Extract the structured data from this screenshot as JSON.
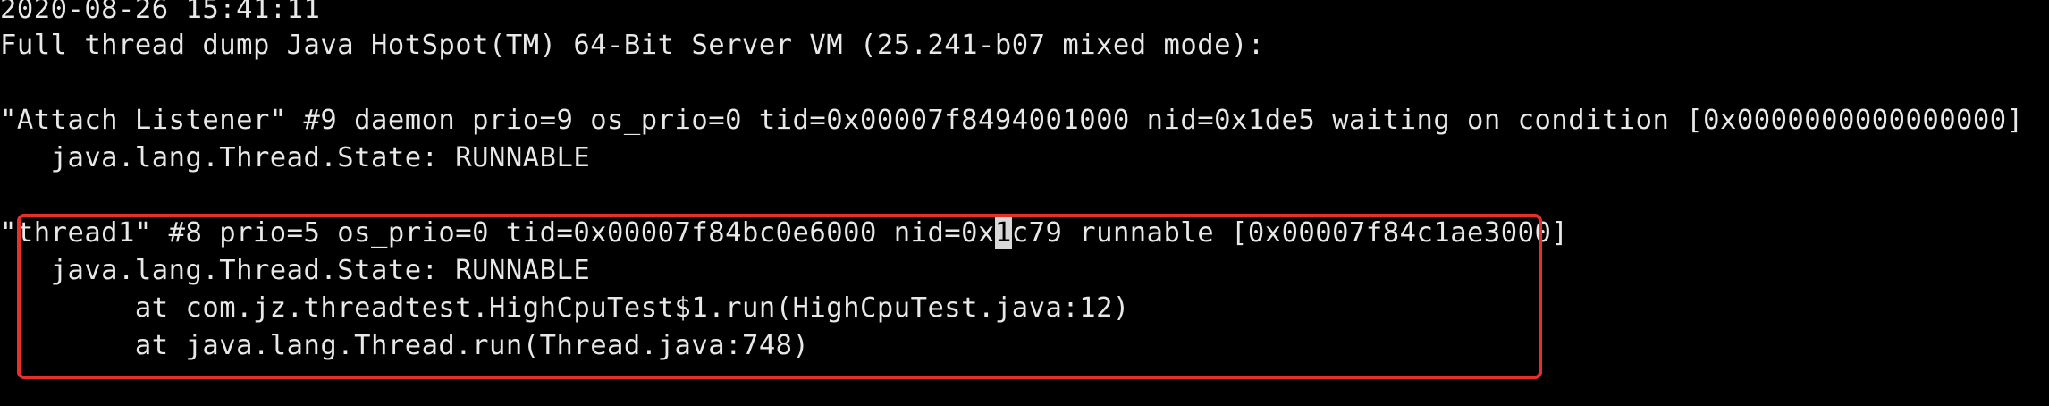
{
  "terminal": {
    "lines": {
      "timestamp": "2020-08-26 15:41:11",
      "header": "Full thread dump Java HotSpot(TM) 64-Bit Server VM (25.241-b07 mixed mode):",
      "attach_thread": "\"Attach Listener\" #9 daemon prio=9 os_prio=0 tid=0x00007f8494001000 nid=0x1de5 waiting on condition [0x0000000000000000]",
      "attach_state": "   java.lang.Thread.State: RUNNABLE",
      "thread1_before_cursor": "\"thread1\" #8 prio=5 os_prio=0 tid=0x00007f84bc0e6000 nid=0x",
      "thread1_cursor_char": "1",
      "thread1_after_cursor": "c79 runnable [0x00007f84c1ae3000]",
      "thread1_state": "   java.lang.Thread.State: RUNNABLE",
      "stack_frame_1": "        at com.jz.threadtest.HighCpuTest$1.run(HighCpuTest.java:12)",
      "stack_frame_2": "        at java.lang.Thread.run(Thread.java:748)"
    },
    "colors": {
      "background": "#000000",
      "text": "#e8e8e8",
      "highlight_border": "#e8302a",
      "cursor": "#d8d8d8"
    }
  }
}
